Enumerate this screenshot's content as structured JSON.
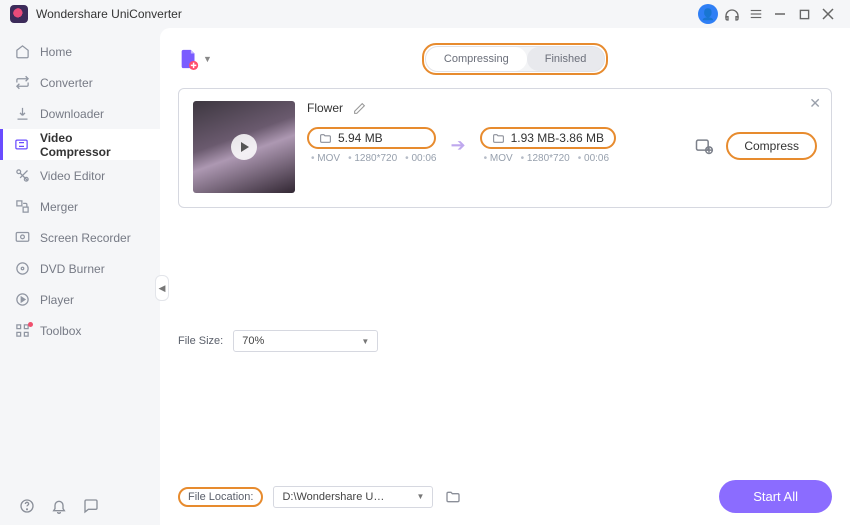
{
  "app": {
    "title": "Wondershare UniConverter"
  },
  "sidebar": {
    "items": [
      {
        "label": "Home"
      },
      {
        "label": "Converter"
      },
      {
        "label": "Downloader"
      },
      {
        "label": "Video Compressor"
      },
      {
        "label": "Video Editor"
      },
      {
        "label": "Merger"
      },
      {
        "label": "Screen Recorder"
      },
      {
        "label": "DVD Burner"
      },
      {
        "label": "Player"
      },
      {
        "label": "Toolbox"
      }
    ]
  },
  "tabs": {
    "compressing": "Compressing",
    "finished": "Finished"
  },
  "file": {
    "name": "Flower",
    "source": {
      "size": "5.94 MB",
      "format": "MOV",
      "resolution": "1280*720",
      "duration": "00:06"
    },
    "target": {
      "size": "1.93 MB-3.86 MB",
      "format": "MOV",
      "resolution": "1280*720",
      "duration": "00:06"
    },
    "compress_label": "Compress"
  },
  "footer": {
    "filesize_label": "File Size:",
    "filesize_value": "70%",
    "location_label": "File Location:",
    "location_value": "D:\\Wondershare UniConverter",
    "start_all": "Start All"
  }
}
